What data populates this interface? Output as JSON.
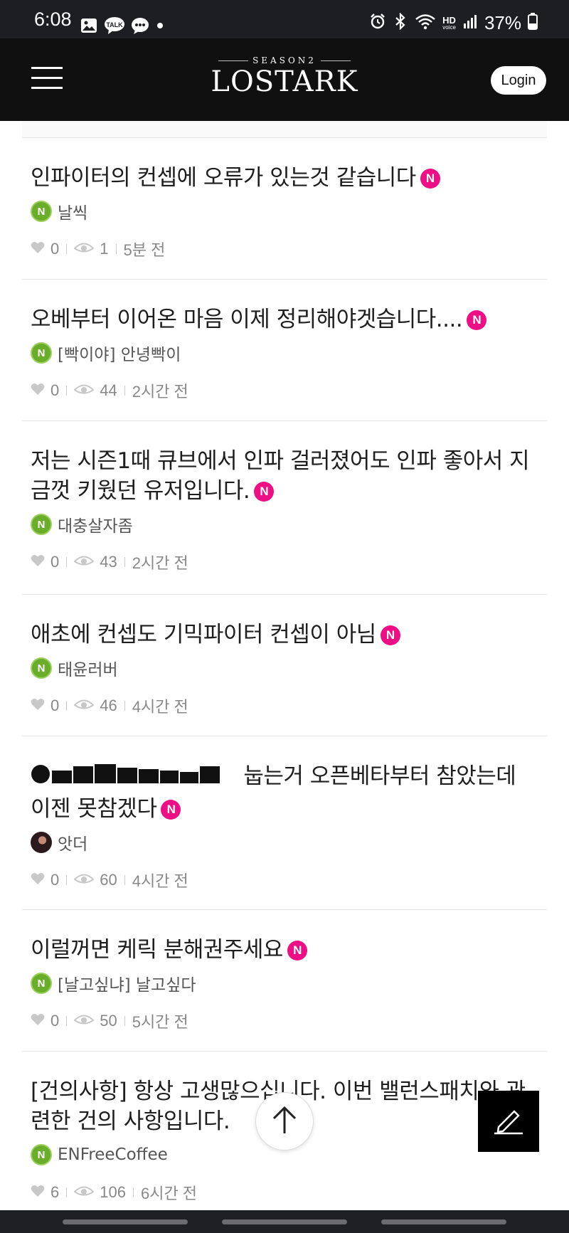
{
  "status_bar": {
    "time": "6:08",
    "left_icons": [
      "image-icon",
      "kakaotalk-icon",
      "chat-bubble-icon",
      "dot-icon"
    ],
    "talk_label": "TALK",
    "hd_label": "HD",
    "voice_label": "voice",
    "battery": "37%"
  },
  "header": {
    "logo_season": "SEASON2",
    "logo_main": "LOSTARK",
    "login_label": "Login"
  },
  "posts": [
    {
      "title": "인파이터의 컨셉에 오류가 있는것 같습니다",
      "badge": "N",
      "author": "날씩",
      "grade": "N",
      "likes": "0",
      "views": "1",
      "time": "5분 전"
    },
    {
      "title": "오베부터 이어온 마음 이제 정리해야겟습니다....",
      "badge": "N",
      "author": "[빡이야] 안녕빡이",
      "grade": "N",
      "likes": "0",
      "views": "44",
      "time": "2시간 전"
    },
    {
      "title": "저는 시즌1때 큐브에서 인파 걸러졌어도 인파 좋아서 지금껏 키웠던 유저입니다.",
      "badge": "N",
      "author": "대충살자좀",
      "grade": "N",
      "likes": "0",
      "views": "43",
      "time": "2시간 전"
    },
    {
      "title": "애초에 컨셉도 기믹파이터 컨셉이 아님",
      "badge": "N",
      "author": "태윤러버",
      "grade": "N",
      "likes": "0",
      "views": "46",
      "time": "4시간 전"
    },
    {
      "title_suffix": "눕는거 오픈베타부터 참았는데 이젠 못참겠다",
      "badge": "N",
      "author": "앗더",
      "likes": "0",
      "views": "60",
      "time": "4시간 전"
    },
    {
      "title": "이럴꺼면 케릭 분해권주세요",
      "badge": "N",
      "author": "[날고싶냐] 날고싶다",
      "grade": "N",
      "likes": "0",
      "views": "50",
      "time": "5시간 전"
    },
    {
      "title": "[건의사항] 항상 고생많으십니다. 이번 밸런스패치와 관련한 건의 사항입니다.",
      "author": "ENFreeCoffee",
      "grade": "N",
      "likes": "6",
      "views": "106",
      "time": "6시간 전"
    }
  ],
  "colors": {
    "accent_badge": "#ee0e86",
    "grade_green": "#6aad2a",
    "header_bg": "#101010"
  }
}
